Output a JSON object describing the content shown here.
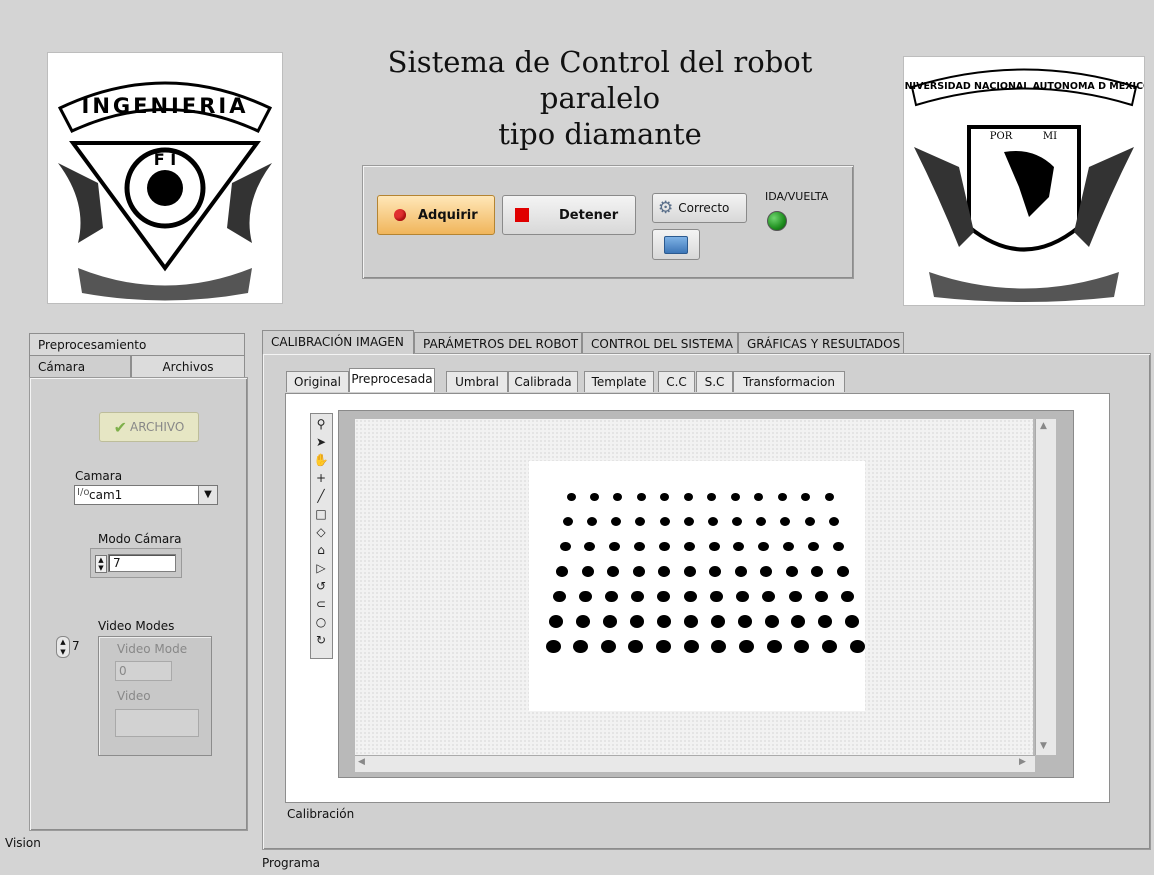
{
  "header": {
    "title_line1": "Sistema de Control del robot paralelo",
    "title_line2": "tipo diamante"
  },
  "logos": {
    "left": {
      "text": "INGENIERIA",
      "inner": "F I"
    },
    "right": {
      "text": "UNIVERSIDAD NACIONAL AUTONOMA D MEXICO",
      "motto_left": "POR",
      "motto_right": "MI"
    }
  },
  "controls": {
    "acquire_label": "Adquirir",
    "stop_label": "Detener",
    "correct_label": "Correcto",
    "led_label": "IDA/VUELTA",
    "colors": {
      "acquire_led": "#e03030",
      "stop_square": "#e00000",
      "led_on": "#1f8f1f"
    }
  },
  "left_panel": {
    "tabs": [
      "Preprocesamiento",
      "Cámara",
      "Archivos"
    ],
    "archivo_button": "ARCHIVO",
    "camera_label": "Camara",
    "camera_value": "cam1",
    "mode_label": "Modo Cámara",
    "mode_value": "7",
    "video_modes_label": "Video Modes",
    "video_modes_index": "7",
    "video_mode_label": "Video Mode",
    "video_mode_value": "0",
    "video_label": "Video",
    "footer": "Vision"
  },
  "main": {
    "tabs": [
      "CALIBRACIÓN IMAGEN",
      "PARÁMETROS DEL ROBOT",
      "CONTROL DEL SISTEMA",
      "GRÁFICAS Y RESULTADOS"
    ],
    "sub_tabs": [
      "Original",
      "Preprocesada",
      "Umbral",
      "Calibrada",
      "Template",
      "C.C",
      "S.C",
      "Transformacion"
    ],
    "selected_sub_tab": "Preprocesada",
    "section_label": "Calibración",
    "footer": "Programa"
  },
  "image_tools": [
    "zoom-icon",
    "pointer-icon",
    "pan-hand-icon",
    "crosshair-icon",
    "line-icon",
    "rectangle-icon",
    "rotated-rect-icon",
    "annulus-icon",
    "polygon-icon",
    "freehand-icon",
    "broken-line-icon",
    "oval-icon",
    "rotate-icon"
  ],
  "grid": {
    "rows": 7,
    "cols": 12
  }
}
